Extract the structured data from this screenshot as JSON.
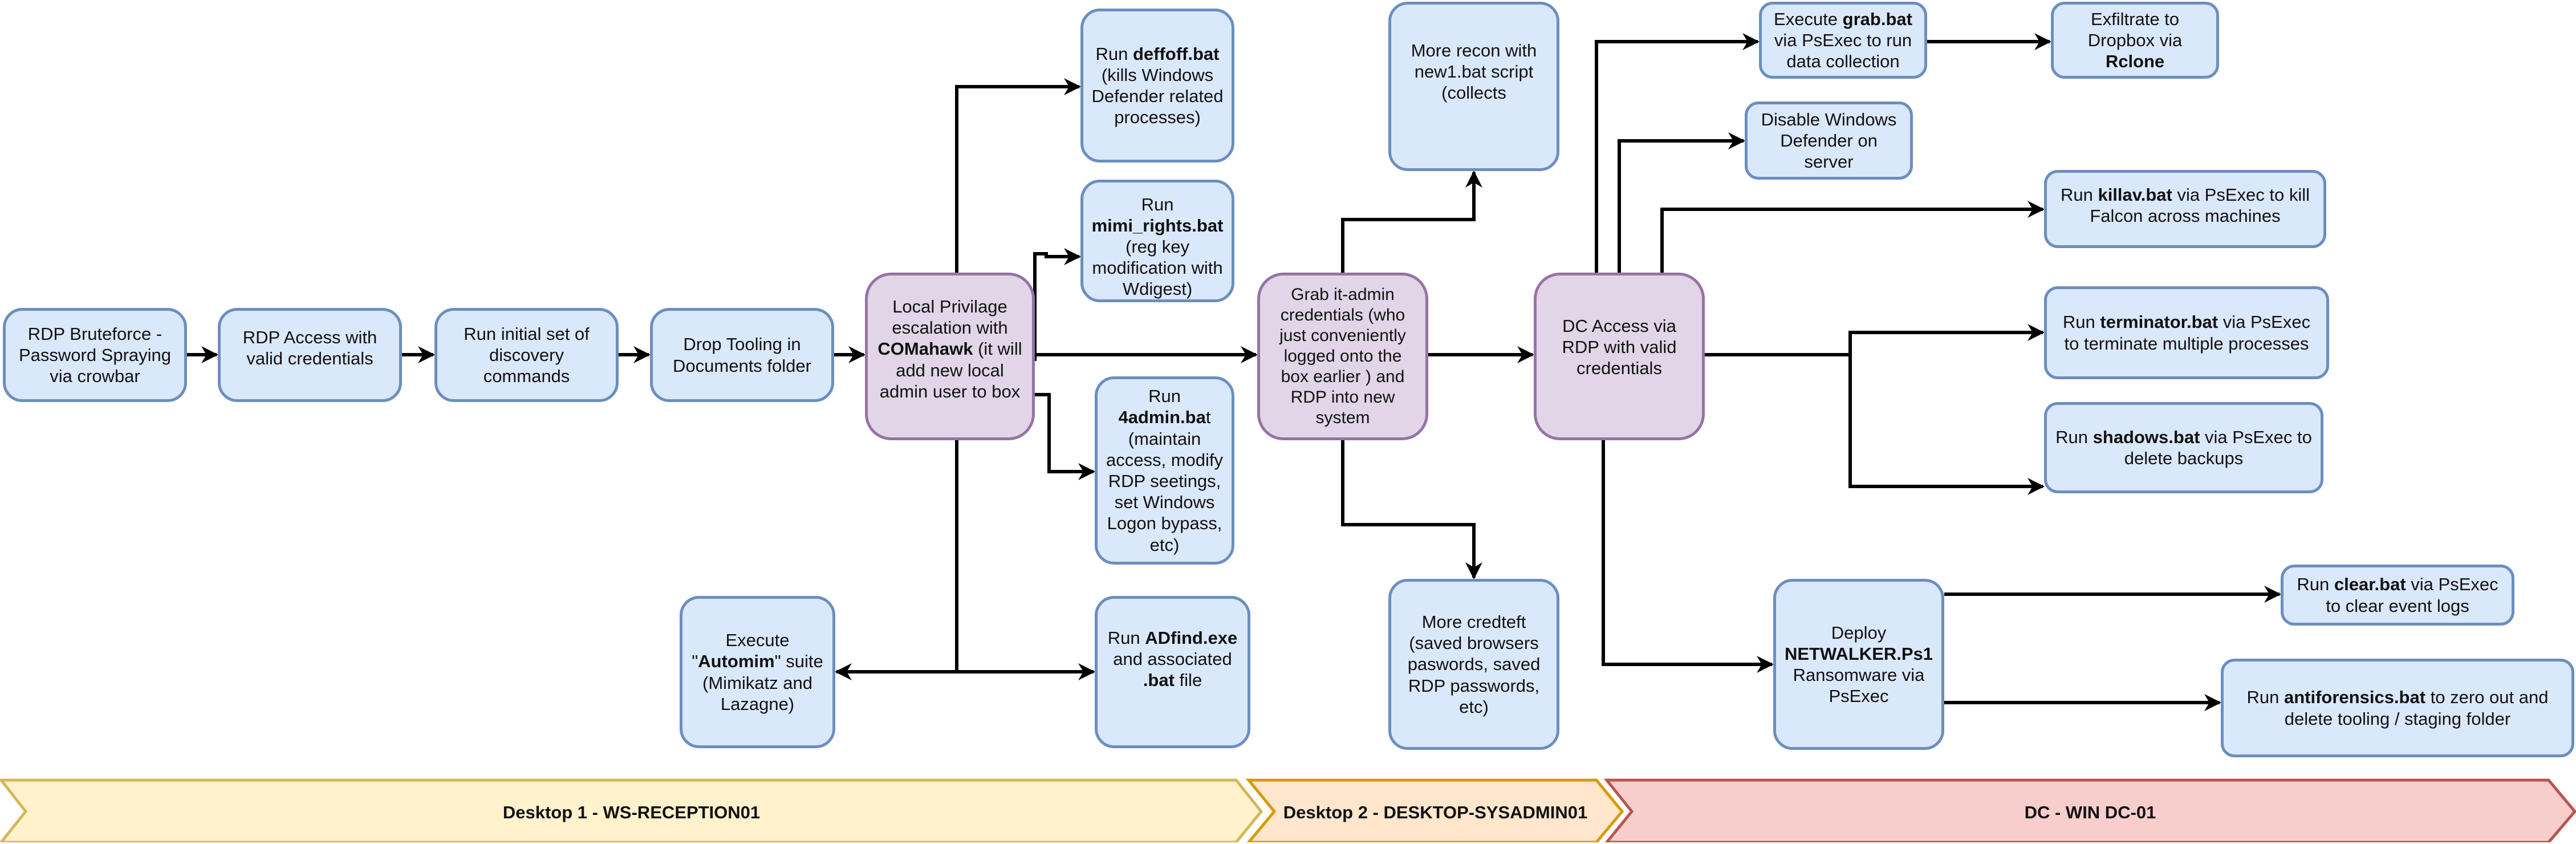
{
  "colors": {
    "step_fill": "#dae8fc",
    "step_stroke": "#6c8ebf",
    "pivot_fill": "#e1d5e7",
    "pivot_stroke": "#9673a6",
    "connector": "#000000",
    "banner_desktop1_fill": "#fff2cc",
    "banner_desktop1_stroke": "#d6b656",
    "banner_desktop2_fill": "#ffe6cc",
    "banner_desktop2_stroke": "#d79b00",
    "banner_dc_fill": "#f8cecc",
    "banner_dc_stroke": "#b85450"
  },
  "nodes": [
    {
      "id": "n1",
      "kind": "step",
      "parts": [
        {
          "t": "RDP Bruteforce - Password Spraying via crowbar"
        }
      ]
    },
    {
      "id": "n2",
      "kind": "step",
      "parts": [
        {
          "t": "RDP Access with valid credentials"
        }
      ]
    },
    {
      "id": "n3",
      "kind": "step",
      "parts": [
        {
          "t": "Run initial set of discovery commands"
        }
      ]
    },
    {
      "id": "n4",
      "kind": "step",
      "parts": [
        {
          "t": "Drop Tooling in Documents folder"
        }
      ]
    },
    {
      "id": "n5",
      "kind": "pivot",
      "parts": [
        {
          "t": "Local Privilage escalation with "
        },
        {
          "t": "COMahawk",
          "b": true
        },
        {
          "t": " (it will add new local admin user to box"
        }
      ]
    },
    {
      "id": "n6",
      "kind": "step",
      "parts": [
        {
          "t": "Run "
        },
        {
          "t": "deffoff.bat",
          "b": true
        },
        {
          "t": " (kills Windows Defender related processes)"
        }
      ]
    },
    {
      "id": "n7",
      "kind": "step",
      "parts": [
        {
          "t": "Run "
        },
        {
          "t": "mimi_rights.bat",
          "b": true
        },
        {
          "t": " (reg key modification with Wdigest)"
        }
      ]
    },
    {
      "id": "n8",
      "kind": "step",
      "parts": [
        {
          "t": "Run "
        },
        {
          "t": "4admin.ba",
          "b": true
        },
        {
          "t": "t (maintain access, modify RDP seetings, set Windows Logon bypass, etc)"
        }
      ]
    },
    {
      "id": "n9",
      "kind": "step",
      "parts": [
        {
          "t": "Run "
        },
        {
          "t": "ADfind.exe",
          "b": true
        },
        {
          "t": " and associated "
        },
        {
          "t": ".bat",
          "b": true
        },
        {
          "t": " file"
        }
      ]
    },
    {
      "id": "n10",
      "kind": "step",
      "parts": [
        {
          "t": "Execute \""
        },
        {
          "t": "Automim",
          "b": true
        },
        {
          "t": "\" suite (Mimikatz and Lazagne)"
        }
      ]
    },
    {
      "id": "n11",
      "kind": "pivot",
      "parts": [
        {
          "t": "Grab it-admin credentials (who just conveniently logged onto the box earlier ) and RDP into new system"
        }
      ]
    },
    {
      "id": "n12",
      "kind": "step",
      "parts": [
        {
          "t": "More recon with new1.bat script (collects"
        }
      ]
    },
    {
      "id": "n13",
      "kind": "step",
      "parts": [
        {
          "t": "More credteft (saved browsers paswords, saved RDP passwords, etc)"
        }
      ]
    },
    {
      "id": "n14",
      "kind": "pivot",
      "parts": [
        {
          "t": "DC Access via RDP with valid credentials"
        }
      ]
    },
    {
      "id": "n15",
      "kind": "step",
      "parts": [
        {
          "t": "Execute "
        },
        {
          "t": "grab.bat",
          "b": true
        },
        {
          "t": " via PsExec to run data collection"
        }
      ]
    },
    {
      "id": "n16",
      "kind": "step",
      "parts": [
        {
          "t": "Exfiltrate to Dropbox via "
        },
        {
          "t": "Rclone",
          "b": true
        }
      ]
    },
    {
      "id": "n17",
      "kind": "step",
      "parts": [
        {
          "t": "Disable Windows Defender on server"
        }
      ]
    },
    {
      "id": "n18",
      "kind": "step",
      "parts": [
        {
          "t": "Run "
        },
        {
          "t": "killav.bat",
          "b": true
        },
        {
          "t": " via PsExec to kill Falcon across machines"
        }
      ]
    },
    {
      "id": "n19",
      "kind": "step",
      "parts": [
        {
          "t": "Run "
        },
        {
          "t": "terminator.bat",
          "b": true
        },
        {
          "t": " via PsExec to terminate multiple processes"
        }
      ]
    },
    {
      "id": "n20",
      "kind": "step",
      "parts": [
        {
          "t": "Run "
        },
        {
          "t": "shadows.bat",
          "b": true
        },
        {
          "t": " via PsExec to delete backups"
        }
      ]
    },
    {
      "id": "n21",
      "kind": "step",
      "parts": [
        {
          "t": "Deploy "
        },
        {
          "t": "NETWALKER.Ps1",
          "b": true
        },
        {
          "t": " Ransomware via PsExec"
        }
      ]
    },
    {
      "id": "n22",
      "kind": "step",
      "parts": [
        {
          "t": "Run "
        },
        {
          "t": "clear.bat",
          "b": true
        },
        {
          "t": " via PsExec to clear event logs"
        }
      ]
    },
    {
      "id": "n23",
      "kind": "step",
      "parts": [
        {
          "t": "Run "
        },
        {
          "t": "antiforensics.bat",
          "b": true
        },
        {
          "t": " to zero out and delete tooling / staging folder"
        }
      ]
    }
  ],
  "edges": [
    {
      "from": "n1",
      "to": "n2"
    },
    {
      "from": "n2",
      "to": "n3"
    },
    {
      "from": "n3",
      "to": "n4"
    },
    {
      "from": "n4",
      "to": "n5"
    },
    {
      "from": "n5",
      "to": "n6"
    },
    {
      "from": "n5",
      "to": "n7"
    },
    {
      "from": "n5",
      "to": "n8"
    },
    {
      "from": "n5",
      "to": "n9"
    },
    {
      "from": "n5",
      "to": "n10"
    },
    {
      "from": "n5",
      "to": "n11"
    },
    {
      "from": "n11",
      "to": "n12"
    },
    {
      "from": "n11",
      "to": "n13"
    },
    {
      "from": "n11",
      "to": "n14"
    },
    {
      "from": "n14",
      "to": "n15"
    },
    {
      "from": "n15",
      "to": "n16"
    },
    {
      "from": "n14",
      "to": "n17"
    },
    {
      "from": "n14",
      "to": "n18"
    },
    {
      "from": "n14",
      "to": "n19"
    },
    {
      "from": "n14",
      "to": "n20"
    },
    {
      "from": "n14",
      "to": "n21"
    },
    {
      "from": "n21",
      "to": "n22"
    },
    {
      "from": "n21",
      "to": "n23"
    }
  ],
  "phases": [
    {
      "id": "desktop1",
      "label": "Desktop 1 - WS-RECEPTION01"
    },
    {
      "id": "desktop2",
      "label": "Desktop 2 - DESKTOP-SYSADMIN01"
    },
    {
      "id": "dc",
      "label": "DC - WIN DC-01"
    }
  ]
}
